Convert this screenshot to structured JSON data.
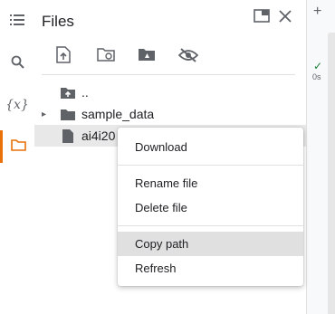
{
  "sidebar": {
    "items": [
      {
        "name": "table-of-contents",
        "icon": "list-icon"
      },
      {
        "name": "search",
        "icon": "search-icon"
      },
      {
        "name": "variables",
        "icon": "variables-icon",
        "label": "{x}"
      },
      {
        "name": "files",
        "icon": "folder-icon",
        "active": true
      }
    ]
  },
  "files_panel": {
    "title": "Files",
    "toolbar": [
      {
        "name": "upload",
        "icon": "upload-file-icon"
      },
      {
        "name": "refresh",
        "icon": "folder-refresh-icon"
      },
      {
        "name": "mount-drive",
        "icon": "drive-folder-icon"
      },
      {
        "name": "toggle-hidden",
        "icon": "eye-off-icon"
      }
    ],
    "tree": [
      {
        "label": "..",
        "icon": "folder-up-icon"
      },
      {
        "label": "sample_data",
        "icon": "folder-icon",
        "expandable": true
      },
      {
        "label": "ai4i20",
        "icon": "file-icon",
        "selected": true
      }
    ]
  },
  "context_menu": {
    "items": [
      {
        "label": "Download"
      },
      {
        "label": "Rename file"
      },
      {
        "label": "Delete file"
      },
      {
        "label": "Copy path"
      },
      {
        "label": "Refresh"
      }
    ]
  },
  "main": {
    "add_symbol": "+",
    "cell_status": "✓",
    "cell_time": "0s"
  },
  "colors": {
    "accent": "#e8710a",
    "icon": "#5f6368",
    "selected_row": "#e8e8e8",
    "hover_item": "#e0e0e0",
    "success": "#188038"
  }
}
